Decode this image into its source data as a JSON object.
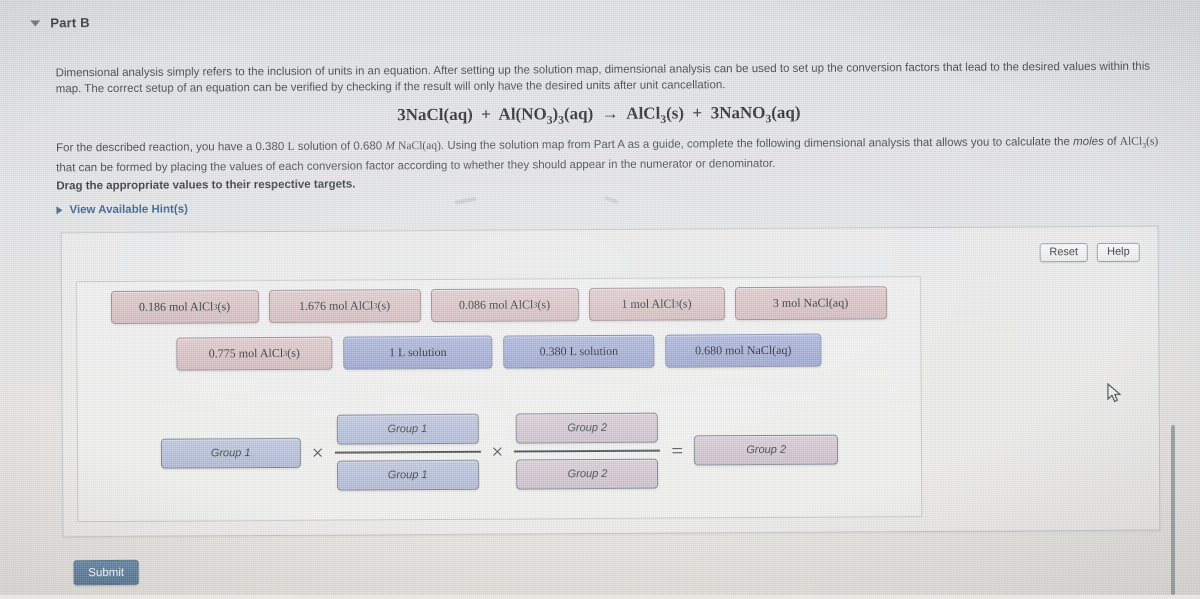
{
  "header": {
    "caret_icon": "caret-down-icon",
    "title": "Part B"
  },
  "body": {
    "paragraph_1": "Dimensional analysis simply refers to the inclusion of units in an equation. After setting up the solution map, dimensional analysis can be used to set up the conversion factors that lead to the desired values within this map. The correct setup of an equation can be verified by checking if the result will only have the desired units after unit cancellation.",
    "equation": "3NaCl(aq) + Al(NO3)3(aq) → AlCl3(s) + 3NaNO3(aq)",
    "paragraph_2_part1": "For the described reaction, you have a 0.380 ",
    "paragraph_2_volume_unit": "L",
    "paragraph_2_part2": " solution of 0.680 ",
    "paragraph_2_molarity_symbol": "M",
    "paragraph_2_solute": "NaCl(aq)",
    "paragraph_2_part3": ". Using the solution map from Part A as a guide, complete the following dimensional analysis that allows you to calculate the ",
    "paragraph_2_italic": "moles",
    "paragraph_2_part4": " of ",
    "paragraph_2_product": "AlCl3(s)",
    "paragraph_2_part5": " that can be formed by placing the values of each conversion factor according to whether they should appear in the numerator or denominator.",
    "drag_instruction": "Drag the appropriate values to their respective targets.",
    "hint_caret_icon": "caret-right-icon",
    "hint_label": "View Available Hint(s)"
  },
  "toolbar": {
    "reset_label": "Reset",
    "help_label": "Help"
  },
  "tiles": {
    "row1": [
      {
        "text": "0.186 mol AlCl3(s)",
        "group": "g1",
        "width": "w-a"
      },
      {
        "text": "1.676 mol AlCl3(s)",
        "group": "g1",
        "width": "w-b"
      },
      {
        "text": "0.086 mol AlCl3(s)",
        "group": "g1",
        "width": "w-c"
      },
      {
        "text": "1 mol AlCl3(s)",
        "group": "g1",
        "width": "w-d"
      },
      {
        "text": "3 mol NaCl(aq)",
        "group": "g1",
        "width": "w-e"
      }
    ],
    "row2": [
      {
        "text": "0.775 mol AlCl3(s)",
        "group": "g1",
        "width": "w-f"
      },
      {
        "text": "1 L solution",
        "group": "g2",
        "width": "w-g"
      },
      {
        "text": "0.380 L solution",
        "group": "g2",
        "width": "w-h"
      },
      {
        "text": "0.680 mol NaCl(aq)",
        "group": "g2",
        "width": "w-i"
      }
    ]
  },
  "expression": {
    "lead_slot_label": "Group 1",
    "operator_1": "×",
    "fraction_1_numerator_label": "Group 1",
    "fraction_1_denominator_label": "Group 1",
    "operator_2": "×",
    "fraction_2_numerator_label": "Group 2",
    "fraction_2_denominator_label": "Group 2",
    "equals": "=",
    "result_slot_label": "Group 2"
  },
  "footer": {
    "submit_label": "Submit"
  },
  "colors": {
    "group1_tile": "#d7bfc2",
    "group2_tile": "#a0acd7",
    "accent_link": "#2f5b8c",
    "submit": "#527a9b"
  }
}
